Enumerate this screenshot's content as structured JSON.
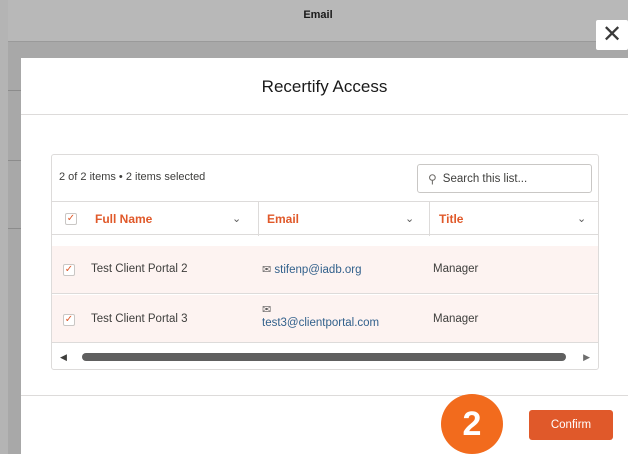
{
  "background": {
    "column_header": "Email"
  },
  "close_glyph": "✕",
  "modal": {
    "title": "Recertify Access"
  },
  "list": {
    "summary": "2 of 2 items • 2 items selected",
    "search_placeholder": "Search this list...",
    "columns": [
      {
        "label": "Full Name"
      },
      {
        "label": "Email"
      },
      {
        "label": "Title"
      }
    ],
    "rows": [
      {
        "name": "Test Client Portal 2",
        "email": "stifenp@iadb.org",
        "title": "Manager",
        "selected": true
      },
      {
        "name": "Test Client Portal 3",
        "email": "test3@clientportal.com",
        "title": "Manager",
        "selected": true
      }
    ]
  },
  "step_badge": "2",
  "footer": {
    "confirm_label": "Confirm"
  },
  "colors": {
    "accent": "#e0592a",
    "badge": "#f26b1d",
    "row_selected_bg": "#fdf3f1",
    "link": "#32618c"
  },
  "icons": {
    "close": "close-icon",
    "search": "search-icon",
    "mail": "mail-icon",
    "chevron": "chevron-down-icon",
    "check": "checkbox-check-icon"
  }
}
